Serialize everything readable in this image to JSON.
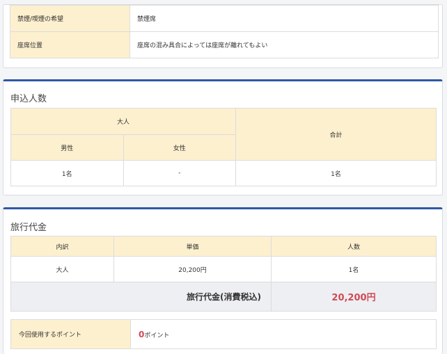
{
  "smoking": {
    "label": "禁煙/喫煙の希望",
    "value": "禁煙席"
  },
  "seat": {
    "label": "座席位置",
    "value": "座席の混み具合によっては座席が離れてもよい"
  },
  "headcount": {
    "title": "申込人数",
    "adult_header": "大人",
    "total_header": "合計",
    "male_header": "男性",
    "female_header": "女性",
    "male_value": "1名",
    "female_value": "-",
    "total_value": "1名"
  },
  "price": {
    "title": "旅行代金",
    "col_breakdown": "内訳",
    "col_unit_price": "単価",
    "col_people": "人数",
    "rows": [
      {
        "type": "大人",
        "unit_price": "20,200円",
        "people": "1名"
      }
    ],
    "total_label": "旅行代金(消費税込)",
    "total_amount": "20,200円"
  },
  "points": {
    "label": "今回使用するポイント",
    "value": "0",
    "unit": "ポイント"
  },
  "colors": {
    "accent": "#2f57a6",
    "label_bg": "#fdf0cf",
    "highlight": "#d04a55"
  }
}
